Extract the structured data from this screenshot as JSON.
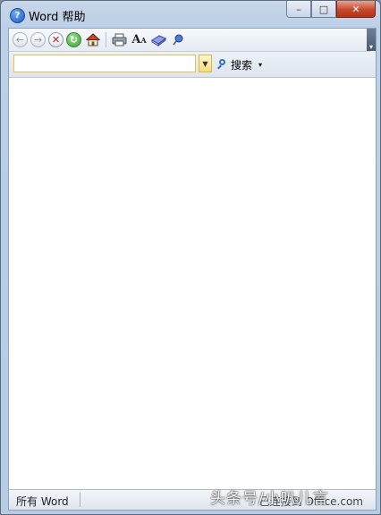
{
  "window": {
    "title": "Word 帮助",
    "help_icon_glyph": "?",
    "buttons": {
      "minimize": "–",
      "maximize": "□",
      "close": "✕"
    }
  },
  "toolbar": {
    "icons": [
      "back-icon",
      "forward-icon",
      "stop-icon",
      "refresh-icon",
      "home-icon",
      "print-icon",
      "font-size-icon",
      "book-icon",
      "pushpin-icon"
    ],
    "glyphs": {
      "back": "←",
      "forward": "→",
      "stop": "✕",
      "refresh": "↻",
      "font_size": "A"
    },
    "overflow_glyph": "▾"
  },
  "search": {
    "value": "",
    "placeholder": "",
    "dropdown_glyph": "▼",
    "button_label": "搜索",
    "button_arrow": "▾"
  },
  "status": {
    "scope": "所有 Word",
    "connection": "已连接到 Office.com"
  },
  "watermark": "头条号/小叭儿言",
  "colors": {
    "accent_yellow": "#f6dc7b",
    "close_red": "#c7482d",
    "chrome_blue": "#bcd0e8"
  }
}
